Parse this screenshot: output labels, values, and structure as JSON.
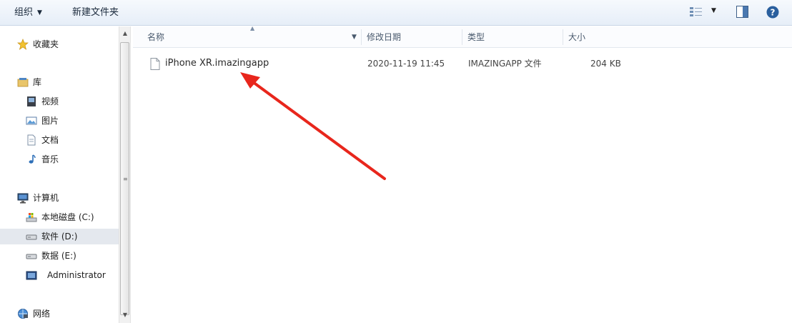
{
  "toolbar": {
    "organize_label": "组织",
    "organize_arrow": "▼",
    "new_folder_label": "新建文件夹",
    "view_arrow": "▼"
  },
  "nav": {
    "items": [
      {
        "label": "收藏夹",
        "icon": "star-icon"
      },
      {
        "label": "库",
        "icon": "library-icon"
      },
      {
        "label": "视频",
        "icon": "video-icon"
      },
      {
        "label": "图片",
        "icon": "picture-icon"
      },
      {
        "label": "文档",
        "icon": "document-icon"
      },
      {
        "label": "音乐",
        "icon": "music-icon"
      },
      {
        "label": "计算机",
        "icon": "computer-icon"
      },
      {
        "label": "本地磁盘 (C:)",
        "icon": "system-drive-icon"
      },
      {
        "label": "软件 (D:)",
        "icon": "drive-icon"
      },
      {
        "label": "数据 (E:)",
        "icon": "drive-icon"
      },
      {
        "label": "Administrator",
        "icon": "user-folder-icon"
      },
      {
        "label": "网络",
        "icon": "network-icon"
      }
    ],
    "selected": "软件 (D:)"
  },
  "columns": {
    "name": "名称",
    "date": "修改日期",
    "type": "类型",
    "size": "大小"
  },
  "files": [
    {
      "name": "iPhone XR.imazingapp",
      "modified": "2020-11-19 11:45",
      "type": "IMAZINGAPP 文件",
      "size": "204 KB"
    }
  ],
  "colors": {
    "annotation_arrow": "#e8261c",
    "selection": "#e4e8ee",
    "toolbar_top": "#f6f9fd",
    "toolbar_bottom": "#e6eef8"
  }
}
